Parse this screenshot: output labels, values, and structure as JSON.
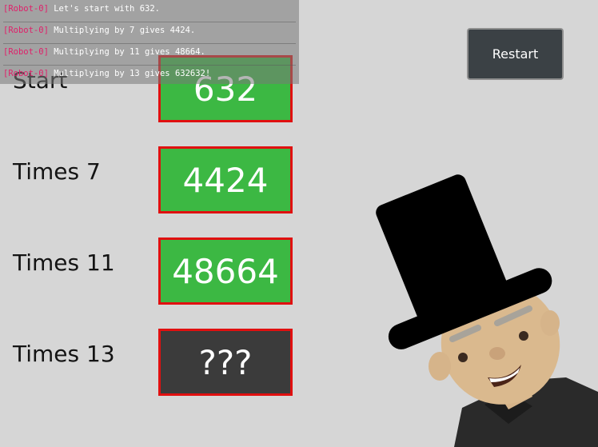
{
  "log": [
    {
      "tag": "[Robot-0]",
      "text": "Let's start with 632."
    },
    {
      "tag": "[Robot-0]",
      "text": "Multiplying by 7 gives 4424."
    },
    {
      "tag": "[Robot-0]",
      "text": "Multiplying by 11 gives 48664."
    },
    {
      "tag": "[Robot-0]",
      "text": "Multiplying by 13 gives 632632!"
    }
  ],
  "rows": [
    {
      "label": "Start",
      "value": "632"
    },
    {
      "label": "Times 7",
      "value": "4424"
    },
    {
      "label": "Times 11",
      "value": "48664"
    },
    {
      "label": "Times 13",
      "value": "???"
    }
  ],
  "restart_label": "Restart",
  "colors": {
    "background": "#d6d6d6",
    "box_green": "#3cb843",
    "box_unknown": "#3b3b3b",
    "box_border": "#e01010",
    "button": "#3b4145",
    "log_tag": "#e0206a"
  },
  "character": {
    "icon": "top-hat-character"
  }
}
